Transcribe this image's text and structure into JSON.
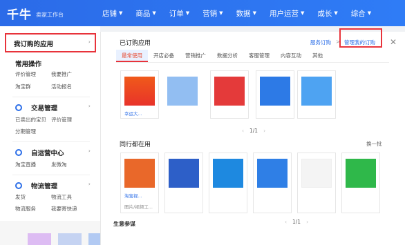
{
  "app": {
    "logo": "千牛",
    "subtitle": "卖家工作台"
  },
  "nav": [
    {
      "label": "店铺"
    },
    {
      "label": "商品"
    },
    {
      "label": "订单"
    },
    {
      "label": "营销"
    },
    {
      "label": "数据"
    },
    {
      "label": "用户运营"
    },
    {
      "label": "成长"
    },
    {
      "label": "综合"
    }
  ],
  "sidebar": {
    "my_apps": "我订购的应用",
    "common_ops": "常用操作",
    "common_links": [
      "评价管理",
      "我要推广",
      "淘宝群",
      "活动报名"
    ],
    "trade": {
      "title": "交易管理",
      "links": [
        "已卖出的宝贝",
        "评价管理",
        "分期管理"
      ]
    },
    "self": {
      "title": "自运营中心",
      "links": [
        "淘宝直播",
        "发微淘"
      ]
    },
    "logistics": {
      "title": "物流管理",
      "links": [
        "发货",
        "物流工具",
        "物流服务",
        "我要寄快递"
      ]
    }
  },
  "panel": {
    "title": "已订购应用",
    "crumb_service": "服务订购",
    "crumb_sep": ">",
    "crumb_manage": "管理我的订购",
    "tabs": [
      "最常使用",
      "开店必备",
      "营销推广",
      "数据分析",
      "客服管理",
      "内容互动",
      "其他"
    ],
    "apps": [
      {
        "label": "幸运大..."
      },
      {
        "label": ""
      },
      {
        "label": ""
      },
      {
        "label": ""
      },
      {
        "label": ""
      }
    ],
    "pager1": "1/1",
    "peers_title": "同行都在用",
    "swap": "换一批",
    "peer_apps": [
      {
        "label": "淘宝视...",
        "sub": "图片/视频工..."
      },
      {
        "label": "",
        "sub": ""
      },
      {
        "label": "",
        "sub": ""
      },
      {
        "label": "",
        "sub": ""
      },
      {
        "label": "",
        "sub": ""
      },
      {
        "label": "",
        "sub": ""
      }
    ],
    "pager2": "1/1",
    "bottom_label": "生意参谋"
  },
  "colors": {
    "brand_blue": "#2f74f0",
    "highlight_red": "#e8333b",
    "tab_active": "#e84a32"
  }
}
